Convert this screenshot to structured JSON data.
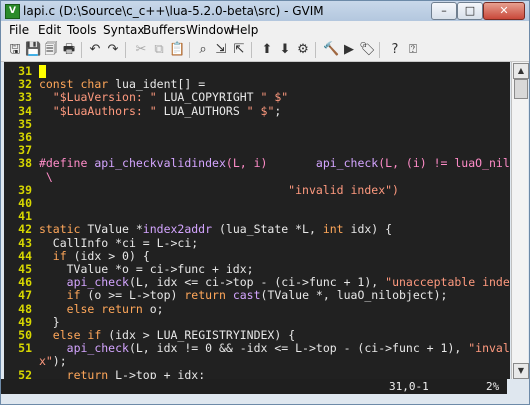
{
  "window": {
    "title": "lapi.c (D:\\Source\\c_c++\\lua-5.2.0-beta\\src) - GVIM",
    "minimize_symbol": "–",
    "maximize_symbol": "□",
    "close_symbol": "✕"
  },
  "menu": [
    "File",
    "Edit",
    "Tools",
    "Syntax",
    "Buffers",
    "Window",
    "Help"
  ],
  "toolbar_icons": [
    "open-icon",
    "save-icon",
    "save-all-icon",
    "print-icon",
    "undo-icon",
    "redo-icon",
    "cut-icon",
    "copy-icon",
    "paste-icon",
    "find-icon",
    "find-next-icon",
    "find-prev-icon",
    "load-session-icon",
    "save-session-icon",
    "run-script-icon",
    "make-icon",
    "shell-icon",
    "ctags-icon",
    "help-icon",
    "find-help-icon"
  ],
  "editor": {
    "lines": [
      {
        "ln": "31",
        "segments": []
      },
      {
        "ln": "32",
        "segments": [
          {
            "t": "kw",
            "x": "const char "
          },
          {
            "t": "code",
            "x": "lua_ident[] ="
          }
        ]
      },
      {
        "ln": "33",
        "segments": [
          {
            "t": "code",
            "x": "  "
          },
          {
            "t": "str",
            "x": "\"$LuaVersion: \""
          },
          {
            "t": "code",
            "x": " LUA_COPYRIGHT "
          },
          {
            "t": "str",
            "x": "\" $\""
          }
        ]
      },
      {
        "ln": "34",
        "segments": [
          {
            "t": "code",
            "x": "  "
          },
          {
            "t": "str",
            "x": "\"$LuaAuthors: \""
          },
          {
            "t": "code",
            "x": " LUA_AUTHORS "
          },
          {
            "t": "str",
            "x": "\" $\""
          },
          {
            "t": "code",
            "x": ";"
          }
        ]
      },
      {
        "ln": "35",
        "segments": []
      },
      {
        "ln": "36",
        "segments": []
      },
      {
        "ln": "37",
        "segments": []
      },
      {
        "ln": "38",
        "segments": [
          {
            "t": "pre",
            "x": "#define "
          },
          {
            "t": "fn",
            "x": "api_checkvalidindex"
          },
          {
            "t": "pre",
            "x": "(L, i)       "
          },
          {
            "t": "fn",
            "x": "api_check"
          },
          {
            "t": "pre",
            "x": "(L, (i) != luaO_nilobject,"
          }
        ]
      },
      {
        "ln": "",
        "segments": [
          {
            "t": "pre",
            "x": " \\"
          }
        ]
      },
      {
        "ln": "39",
        "segments": [
          {
            "t": "str",
            "x": "                                    \"invalid index\")"
          }
        ]
      },
      {
        "ln": "40",
        "segments": []
      },
      {
        "ln": "41",
        "segments": []
      },
      {
        "ln": "42",
        "segments": [
          {
            "t": "kw",
            "x": "static "
          },
          {
            "t": "code",
            "x": "TValue *"
          },
          {
            "t": "fn",
            "x": "index2addr"
          },
          {
            "t": "code",
            "x": " (lua_State *L, "
          },
          {
            "t": "kw",
            "x": "int"
          },
          {
            "t": "code",
            "x": " idx) {"
          }
        ]
      },
      {
        "ln": "43",
        "segments": [
          {
            "t": "code",
            "x": "  CallInfo *ci = L->ci;"
          }
        ]
      },
      {
        "ln": "44",
        "segments": [
          {
            "t": "code",
            "x": "  "
          },
          {
            "t": "kw",
            "x": "if"
          },
          {
            "t": "code",
            "x": " (idx > 0) {"
          }
        ]
      },
      {
        "ln": "45",
        "segments": [
          {
            "t": "code",
            "x": "    TValue *o = ci->func + idx;"
          }
        ]
      },
      {
        "ln": "46",
        "segments": [
          {
            "t": "code",
            "x": "    "
          },
          {
            "t": "fn",
            "x": "api_check"
          },
          {
            "t": "code",
            "x": "(L, idx <= ci->top - (ci->func + 1), "
          },
          {
            "t": "str",
            "x": "\"unacceptable index\""
          },
          {
            "t": "code",
            "x": ");"
          }
        ]
      },
      {
        "ln": "47",
        "segments": [
          {
            "t": "code",
            "x": "    "
          },
          {
            "t": "kw",
            "x": "if"
          },
          {
            "t": "code",
            "x": " (o >= L->top) "
          },
          {
            "t": "kw",
            "x": "return "
          },
          {
            "t": "fn",
            "x": "cast"
          },
          {
            "t": "code",
            "x": "(TValue *, luaO_nilobject);"
          }
        ]
      },
      {
        "ln": "48",
        "segments": [
          {
            "t": "code",
            "x": "    "
          },
          {
            "t": "kw",
            "x": "else return "
          },
          {
            "t": "code",
            "x": "o;"
          }
        ]
      },
      {
        "ln": "49",
        "segments": [
          {
            "t": "code",
            "x": "  }"
          }
        ]
      },
      {
        "ln": "50",
        "segments": [
          {
            "t": "code",
            "x": "  "
          },
          {
            "t": "kw",
            "x": "else if"
          },
          {
            "t": "code",
            "x": " (idx > LUA_REGISTRYINDEX) {"
          }
        ]
      },
      {
        "ln": "51",
        "segments": [
          {
            "t": "code",
            "x": "    "
          },
          {
            "t": "fn",
            "x": "api_check"
          },
          {
            "t": "code",
            "x": "(L, idx != 0 && -idx <= L->top - (ci->func + 1), "
          },
          {
            "t": "str",
            "x": "\"invalid inde"
          }
        ]
      },
      {
        "ln": "",
        "segments": [
          {
            "t": "str",
            "x": "x\""
          },
          {
            "t": "code",
            "x": ");"
          }
        ]
      },
      {
        "ln": "52",
        "segments": [
          {
            "t": "code",
            "x": "    "
          },
          {
            "t": "kw",
            "x": "return "
          },
          {
            "t": "code",
            "x": "L->top + idx;"
          }
        ]
      }
    ]
  },
  "status": {
    "position": "31,0-1",
    "percent": "2%"
  },
  "scrollbar": {
    "up_symbol": "▲",
    "down_symbol": "▼"
  }
}
